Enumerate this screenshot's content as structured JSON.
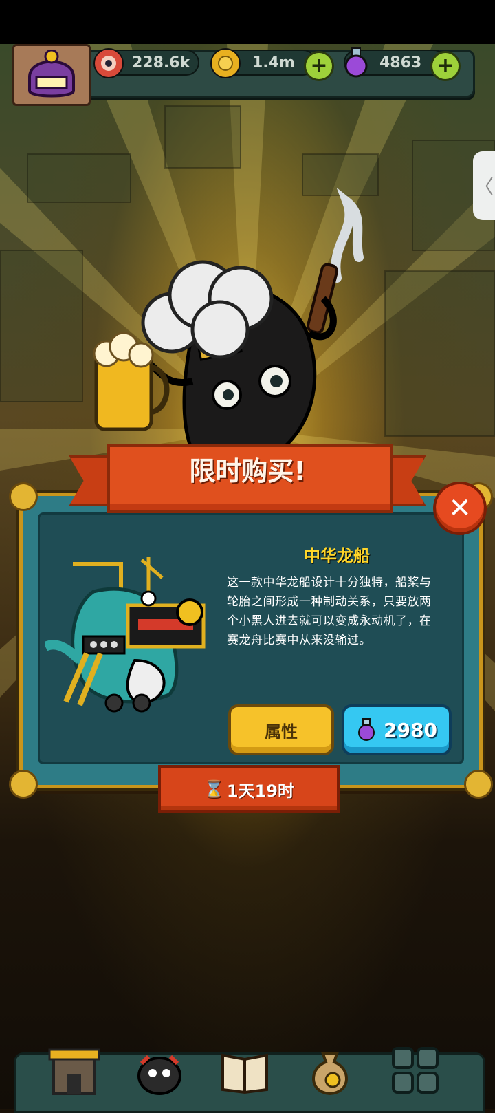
{
  "resources": {
    "eyes": "228.6k",
    "coins": "1.4m",
    "potions": "4863"
  },
  "offer": {
    "title": "限时购买!",
    "item_name": "中华龙船",
    "description": "这一款中华龙船设计十分独特，船桨与轮胎之间形成一种制动关系，只要放两个小黑人进去就可以变成永动机了，在赛龙舟比赛中从来没输过。",
    "attributes_label": "属性",
    "price": "2980",
    "timer": "1天19时"
  },
  "icons": {
    "side_tab": "chevron-left-icon",
    "close": "close-icon",
    "potion": "potion-icon",
    "hourglass": "hourglass-icon"
  },
  "colors": {
    "accent_gold": "#ffd62a",
    "button_yellow": "#f6c22a",
    "button_blue": "#35c8f2",
    "ribbon_red": "#e0501e",
    "panel_teal": "#1f4d55"
  }
}
